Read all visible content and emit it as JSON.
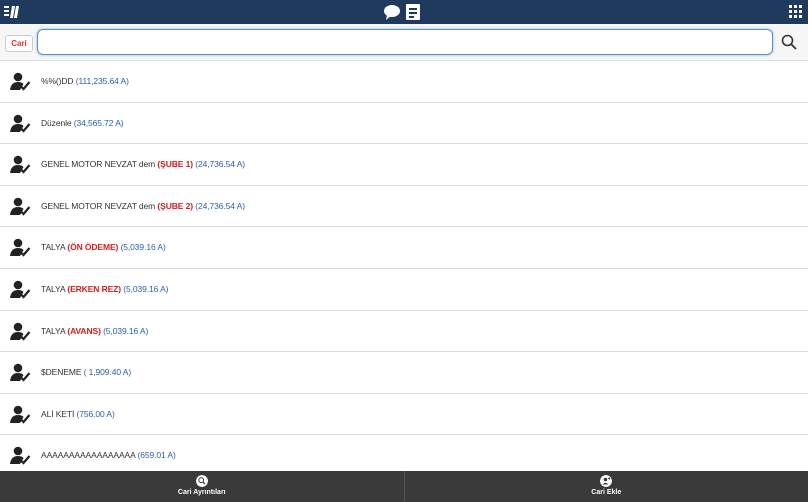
{
  "search": {
    "tag_label": "Cari",
    "value": "",
    "placeholder": ""
  },
  "items": [
    {
      "name": "%%()DD",
      "tag": "",
      "amount": "(111,235.64 A)"
    },
    {
      "name": "Düzenle",
      "tag": "",
      "amount": "(34,565.72 A)"
    },
    {
      "name": "GENEL MOTOR NEVZAT dem",
      "tag": "(ŞUBE 1)",
      "amount": "(24,736.54 A)"
    },
    {
      "name": "GENEL MOTOR NEVZAT dem",
      "tag": "(ŞUBE 2)",
      "amount": "(24,736.54 A)"
    },
    {
      "name": "TALYA",
      "tag": "(ÖN ÖDEME)",
      "amount": "(5,039.16 A)"
    },
    {
      "name": "TALYA",
      "tag": "(ERKEN REZ)",
      "amount": "(5,039.16 A)"
    },
    {
      "name": "TALYA",
      "tag": "(AVANS)",
      "amount": "(5,039.16 A)"
    },
    {
      "name": "$DENEME",
      "tag": "",
      "amount": "( 1,909.40 A)"
    },
    {
      "name": "ALİ KETİ",
      "tag": "",
      "amount": "(756.00 A)"
    },
    {
      "name": "AAAAAAAAAAAAAAAAA",
      "tag": "",
      "amount": "(659.01 A)"
    }
  ],
  "bottom": {
    "left_label": "Cari Ayrıntıları",
    "right_label": "Cari Ekle"
  },
  "icons": {
    "top_left": "logo-icon",
    "top_center_1": "chat-icon",
    "top_center_2": "document-icon",
    "top_right": "grid-menu-icon",
    "row": "user-check-icon",
    "search": "search-icon"
  },
  "colors": {
    "topbar": "#1f3a5c",
    "bottombar": "#3a3a3a",
    "tag_red": "#d0211c",
    "amount_blue": "#2a5db0"
  }
}
